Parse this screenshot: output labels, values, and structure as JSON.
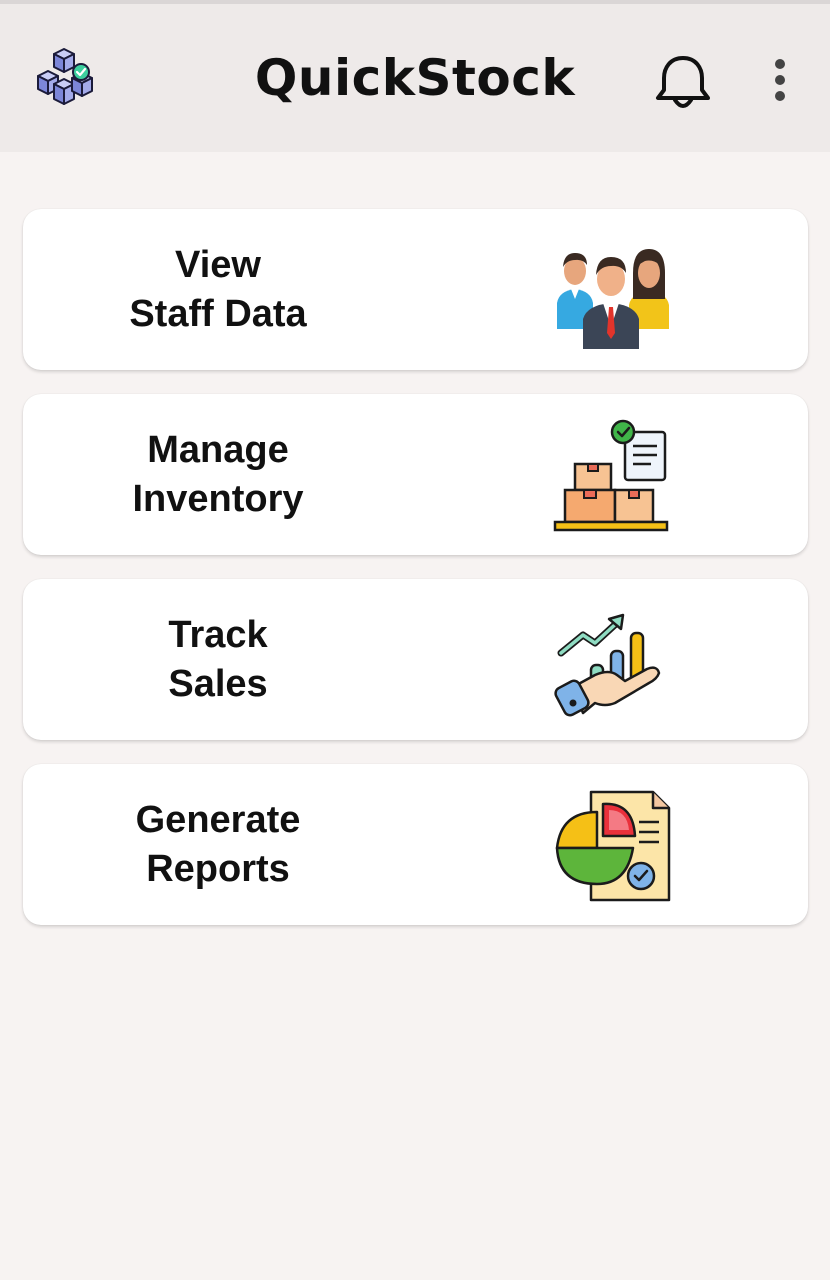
{
  "app": {
    "title": "QuickStock",
    "logo_icon": "stacked-boxes-check-icon",
    "notification_icon": "bell-icon",
    "menu_icon": "more-vertical-icon"
  },
  "menu": {
    "items": [
      {
        "label": "View\nStaff Data",
        "icon": "staff-group-icon"
      },
      {
        "label": "Manage\nInventory",
        "icon": "inventory-boxes-icon"
      },
      {
        "label": "Track\nSales",
        "icon": "sales-chart-hand-icon"
      },
      {
        "label": "Generate\nReports",
        "icon": "report-pie-chart-icon"
      }
    ]
  },
  "colors": {
    "appbar_bg": "#eeeae9",
    "page_bg": "#f7f3f2",
    "card_bg": "#ffffff",
    "text": "#111111"
  }
}
